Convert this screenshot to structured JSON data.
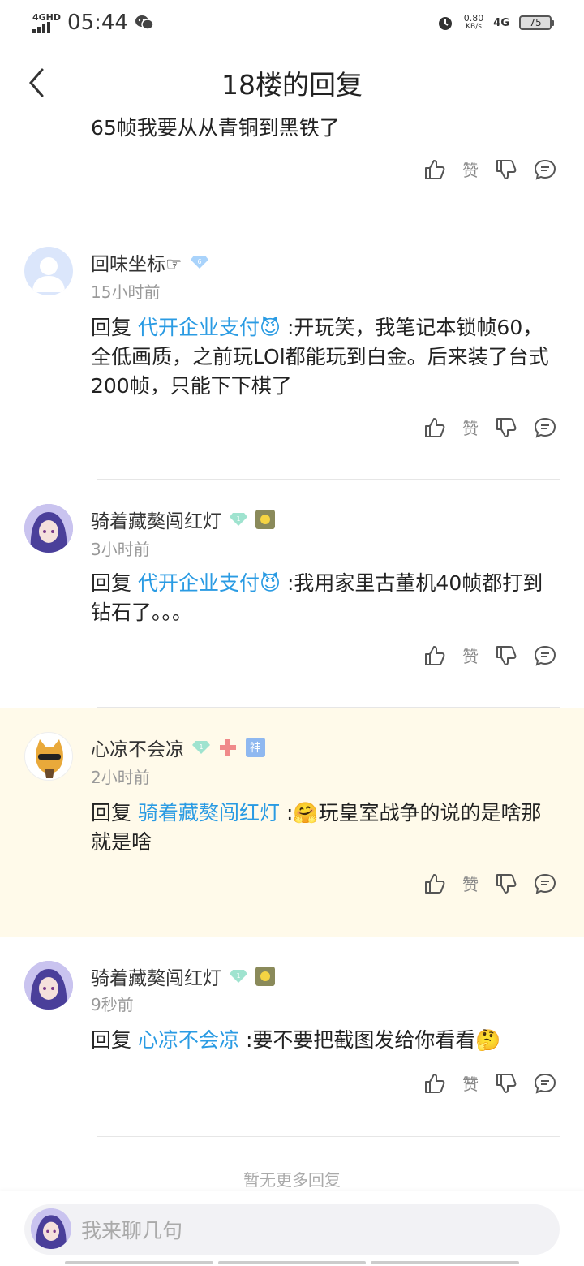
{
  "status": {
    "network_small": "4GHD",
    "time": "05:44",
    "speed_value": "0.80",
    "speed_unit": "KB/s",
    "net_type": "4G",
    "battery": "75"
  },
  "nav": {
    "title": "18楼的回复"
  },
  "actions": {
    "like_label": "赞"
  },
  "top_comment": {
    "text": "65帧我要从从青铜到黑铁了"
  },
  "comments": [
    {
      "name": "回味坐标☞",
      "time": "15小时前",
      "prefix": "回复",
      "mention": "代开企业支付😈",
      "text": ":开玩笑，我笔记本锁帧60，全低画质，之前玩LOl都能玩到白金。后来装了台式200帧，只能下下棋了",
      "badge_level": "6"
    },
    {
      "name": "骑着藏獒闯红灯",
      "time": "3小时前",
      "prefix": "回复",
      "mention": "代开企业支付😈",
      "text": ":我用家里古董机40帧都打到钻石了。。。",
      "badge_level": "1"
    },
    {
      "name": "心凉不会凉",
      "time": "2小时前",
      "prefix": "回复",
      "mention": "骑着藏獒闯红灯",
      "text": ":🤗玩皇室战争的说的是啥那就是啥",
      "badge_level": "1",
      "badge_god": "神"
    },
    {
      "name": "骑着藏獒闯红灯",
      "time": "9秒前",
      "prefix": "回复",
      "mention": "心凉不会凉",
      "text": ":要不要把截图发给你看看🤔",
      "badge_level": "1"
    }
  ],
  "no_more": "暂无更多回复",
  "input": {
    "placeholder": "我来聊几句"
  },
  "colors": {
    "link": "#2a9be3",
    "highlight_bg": "#fffaea"
  }
}
